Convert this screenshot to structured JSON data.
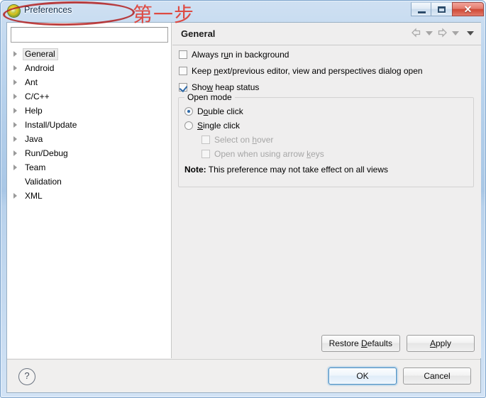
{
  "window": {
    "title": "Preferences",
    "app_icon": "eclipse-icon",
    "controls": {
      "minimize": "minimize-icon",
      "maximize": "maximize-icon",
      "close": "✕"
    }
  },
  "annotation": {
    "ellipse": "red-ellipse-highlight",
    "text": "第一步",
    "color": "#e03a30"
  },
  "filter": {
    "value": "",
    "placeholder": ""
  },
  "tree": {
    "items": [
      {
        "label": "General",
        "expandable": true,
        "selected": true
      },
      {
        "label": "Android",
        "expandable": true,
        "selected": false
      },
      {
        "label": "Ant",
        "expandable": true,
        "selected": false
      },
      {
        "label": "C/C++",
        "expandable": true,
        "selected": false
      },
      {
        "label": "Help",
        "expandable": true,
        "selected": false
      },
      {
        "label": "Install/Update",
        "expandable": true,
        "selected": false
      },
      {
        "label": "Java",
        "expandable": true,
        "selected": false
      },
      {
        "label": "Run/Debug",
        "expandable": true,
        "selected": false
      },
      {
        "label": "Team",
        "expandable": true,
        "selected": false
      },
      {
        "label": "Validation",
        "expandable": false,
        "selected": false
      },
      {
        "label": "XML",
        "expandable": true,
        "selected": false
      }
    ]
  },
  "pane": {
    "title": "General",
    "nav": {
      "back": "back-arrow-icon",
      "back_menu": "chevron-down-icon",
      "forward": "forward-arrow-icon",
      "forward_menu": "chevron-down-icon",
      "view_menu": "chevron-down-icon"
    },
    "checkboxes": [
      {
        "label_pre": "Always r",
        "mnemonic": "u",
        "label_post": "n in background",
        "checked": false,
        "disabled": false
      },
      {
        "label_pre": "Keep ",
        "mnemonic": "n",
        "label_post": "ext/previous editor, view and perspectives dialog open",
        "checked": false,
        "disabled": false
      },
      {
        "label_pre": "Sho",
        "mnemonic": "w",
        "label_post": " heap status",
        "checked": true,
        "disabled": false
      }
    ],
    "group": {
      "title": "Open mode",
      "radios": [
        {
          "label_pre": "D",
          "mnemonic": "o",
          "label_post": "uble click",
          "selected": true,
          "disabled": false
        },
        {
          "label_pre": "",
          "mnemonic": "S",
          "label_post": "ingle click",
          "selected": false,
          "disabled": false
        }
      ],
      "sub_checkboxes": [
        {
          "label_pre": "Select on ",
          "mnemonic": "h",
          "label_post": "over",
          "checked": false,
          "disabled": true
        },
        {
          "label_pre": "Open when using arrow ",
          "mnemonic": "k",
          "label_post": "eys",
          "checked": false,
          "disabled": true
        }
      ],
      "note_label": "Note:",
      "note_text": " This preference may not take effect on all views"
    },
    "buttons": {
      "restore_pre": "Restore ",
      "restore_mnemonic": "D",
      "restore_post": "efaults",
      "apply_pre": "",
      "apply_mnemonic": "A",
      "apply_post": "pply"
    }
  },
  "footer": {
    "help": "?",
    "ok": "OK",
    "cancel": "Cancel"
  }
}
